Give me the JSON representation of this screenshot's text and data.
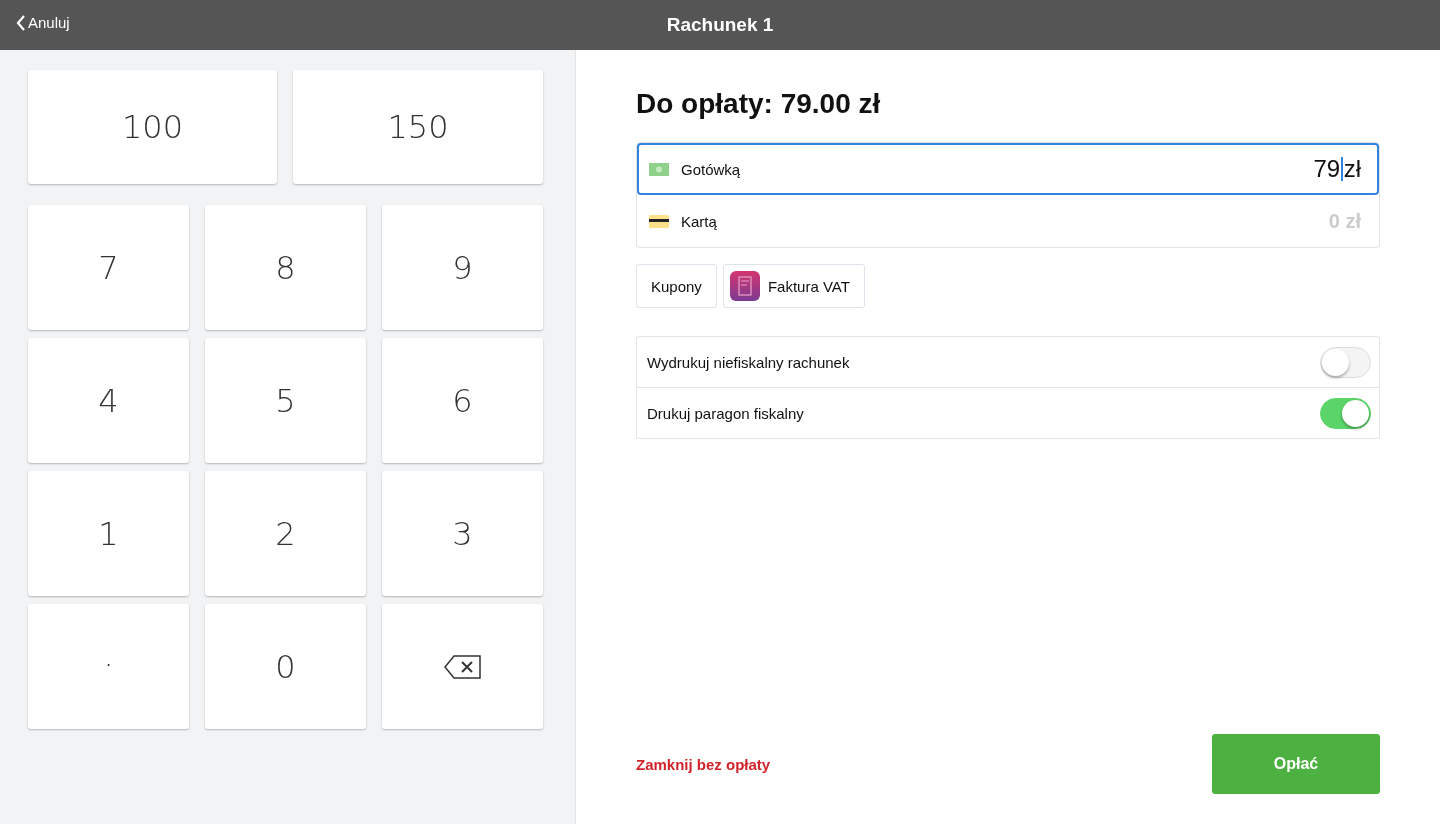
{
  "header": {
    "back": "Anuluj",
    "title": "Rachunek 1"
  },
  "quick_amounts": [
    "100",
    "150"
  ],
  "keypad": [
    {
      "kind": "digit",
      "label": "7"
    },
    {
      "kind": "digit",
      "label": "8"
    },
    {
      "kind": "digit",
      "label": "9"
    },
    {
      "kind": "digit",
      "label": "4"
    },
    {
      "kind": "digit",
      "label": "5"
    },
    {
      "kind": "digit",
      "label": "6"
    },
    {
      "kind": "digit",
      "label": "1"
    },
    {
      "kind": "digit",
      "label": "2"
    },
    {
      "kind": "digit",
      "label": "3"
    },
    {
      "kind": "decimal",
      "label": "."
    },
    {
      "kind": "digit",
      "label": "0"
    },
    {
      "kind": "backspace"
    }
  ],
  "due": "Do opłaty: 79.00 zł",
  "payments": [
    {
      "kind": "cash",
      "label": "Gotówką",
      "amount": "79",
      "currency": "zł",
      "selected": true
    },
    {
      "kind": "card",
      "label": "Kartą",
      "amount": "0",
      "currency": "zł",
      "selected": false
    }
  ],
  "extras": [
    {
      "kind": "plain",
      "label": "Kupony"
    },
    {
      "kind": "invoice",
      "label": "Faktura VAT"
    }
  ],
  "toggles": [
    {
      "label": "Wydrukuj niefiskalny rachunek",
      "on": false
    },
    {
      "label": "Drukuj paragon fiskalny",
      "on": true
    }
  ],
  "close_link": "Zamknij bez opłaty",
  "pay_button": "Opłać"
}
